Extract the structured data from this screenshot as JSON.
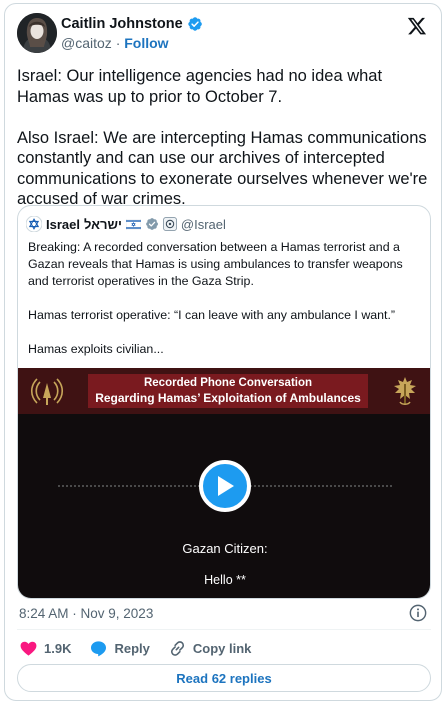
{
  "author": {
    "display_name": "Caitlin Johnstone",
    "handle": "@caitoz",
    "separator": "·",
    "follow_label": "Follow"
  },
  "tweet": {
    "text": "Israel: Our intelligence agencies had no idea what Hamas was up to prior to October 7.\n\nAlso Israel: We are intercepting Hamas communications constantly and can use our archives of intercepted communications to exonerate ourselves whenever we're accused of war crimes.",
    "timestamp": "8:24 AM · Nov 9, 2023"
  },
  "quoted": {
    "name": "Israel",
    "name_hebrew": "ישראל",
    "handle": "@Israel",
    "text": "Breaking: A recorded conversation between a Hamas terrorist and a Gazan reveals that Hamas is using ambulances to transfer weapons and terrorist operatives in the Gaza Strip.\n\nHamas terrorist operative: “I can leave with any ambulance I want.”\n\nHamas exploits civilian...",
    "video": {
      "banner_line1": "Recorded Phone Conversation",
      "banner_line2": "Regarding Hamas’ Exploitation of Ambulances",
      "speaker": "Gazan Citizen:",
      "caption": "Hello **"
    }
  },
  "actions": {
    "likes": "1.9K",
    "reply_label": "Reply",
    "copy_link_label": "Copy link",
    "read_replies_label": "Read 62 replies"
  },
  "colors": {
    "accent": "#1d9bf0",
    "link": "#1d74bf",
    "like": "#f91880",
    "banner_red": "#7a1a1f"
  },
  "icons": [
    "verified-badge-icon",
    "x-logo-icon",
    "israel-flag-icon",
    "gov-badge-icon",
    "play-icon",
    "radio-icon",
    "idf-emblem-icon",
    "info-icon",
    "heart-icon",
    "reply-icon",
    "link-icon"
  ]
}
